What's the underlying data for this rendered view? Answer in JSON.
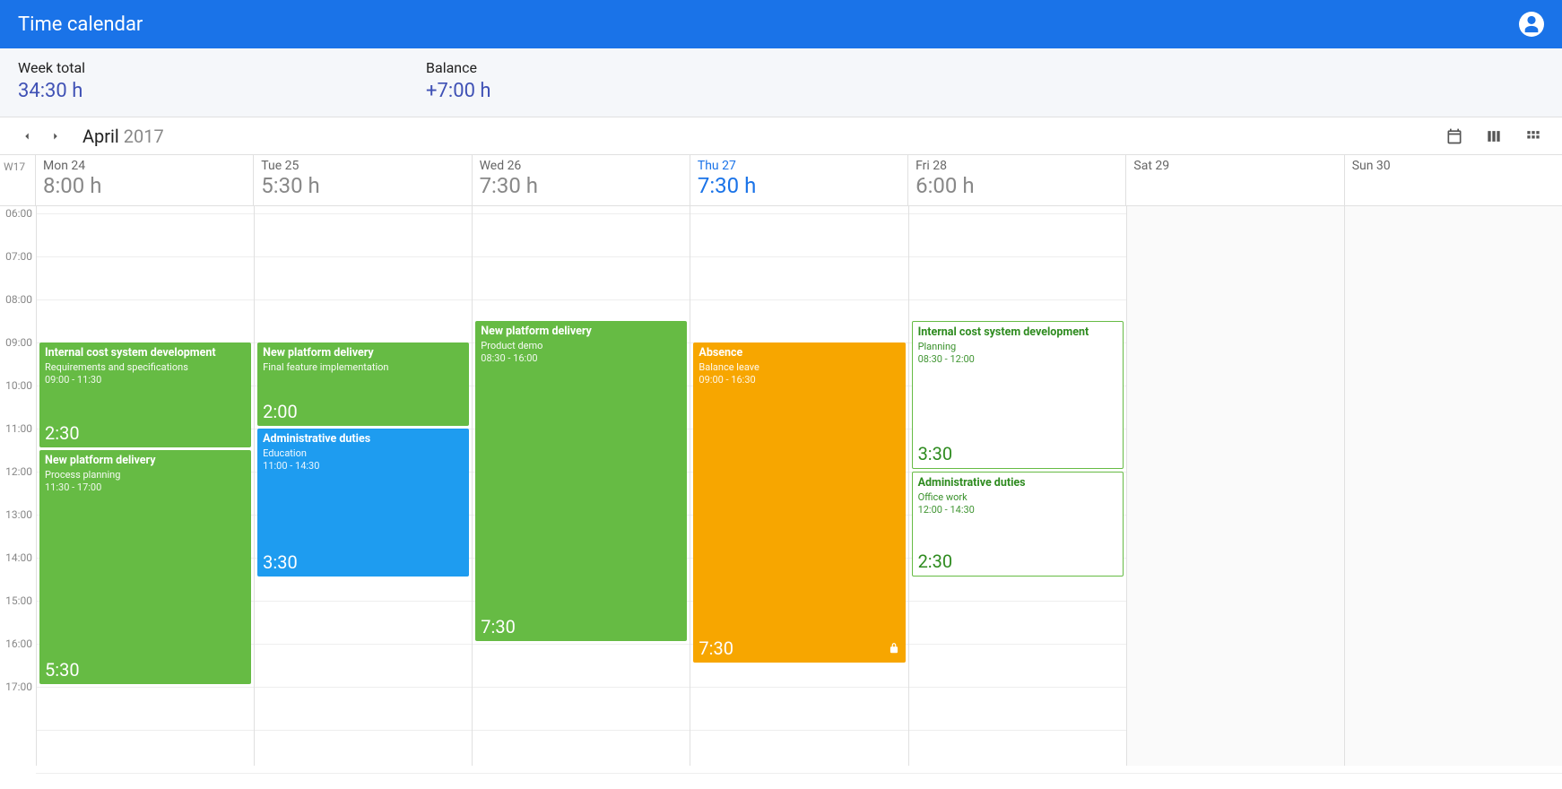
{
  "header": {
    "title": "Time calendar"
  },
  "summary": {
    "weekTotalLabel": "Week total",
    "weekTotalValue": "34:30 h",
    "balanceLabel": "Balance",
    "balanceValue": "+7:00 h"
  },
  "nav": {
    "month": "April",
    "year": "2017"
  },
  "weekLabel": "W17",
  "days": [
    {
      "label": "Mon 24",
      "hours": "8:00 h",
      "today": false,
      "weekend": false
    },
    {
      "label": "Tue 25",
      "hours": "5:30 h",
      "today": false,
      "weekend": false
    },
    {
      "label": "Wed 26",
      "hours": "7:30 h",
      "today": false,
      "weekend": false
    },
    {
      "label": "Thu 27",
      "hours": "7:30 h",
      "today": true,
      "weekend": false
    },
    {
      "label": "Fri 28",
      "hours": "6:00 h",
      "today": false,
      "weekend": false
    },
    {
      "label": "Sat 29",
      "hours": "",
      "today": false,
      "weekend": true
    },
    {
      "label": "Sun 30",
      "hours": "",
      "today": false,
      "weekend": true
    }
  ],
  "timeTicks": [
    "06:00",
    "07:00",
    "08:00",
    "09:00",
    "10:00",
    "11:00",
    "12:00",
    "13:00",
    "14:00",
    "15:00",
    "16:00",
    "17:00"
  ],
  "gridStartHour": 6,
  "hourPx": 48,
  "events": [
    {
      "day": 0,
      "title": "Internal cost system development",
      "sub": "Requirements and specifications",
      "time": "09:00 - 11:30",
      "startH": 9,
      "endH": 11.5,
      "dur": "2:30",
      "style": "green"
    },
    {
      "day": 0,
      "title": "New platform delivery",
      "sub": "Process planning",
      "time": "11:30 - 17:00",
      "startH": 11.5,
      "endH": 17,
      "dur": "5:30",
      "style": "green"
    },
    {
      "day": 1,
      "title": "New platform delivery",
      "sub": "Final feature implementation",
      "time": "",
      "startH": 9,
      "endH": 11,
      "dur": "2:00",
      "style": "green"
    },
    {
      "day": 1,
      "title": "Administrative duties",
      "sub": "Education",
      "time": "11:00 - 14:30",
      "startH": 11,
      "endH": 14.5,
      "dur": "3:30",
      "style": "blue"
    },
    {
      "day": 2,
      "title": "New platform delivery",
      "sub": "Product demo",
      "time": "08:30 - 16:00",
      "startH": 8.5,
      "endH": 16,
      "dur": "7:30",
      "style": "green"
    },
    {
      "day": 3,
      "title": "Absence",
      "sub": "Balance leave",
      "time": "09:00 - 16:30",
      "startH": 9,
      "endH": 16.5,
      "dur": "7:30",
      "style": "orange",
      "locked": true
    },
    {
      "day": 4,
      "title": "Internal cost system development",
      "sub": "Planning",
      "time": "08:30 - 12:00",
      "startH": 8.5,
      "endH": 12,
      "dur": "3:30",
      "style": "outline-green"
    },
    {
      "day": 4,
      "title": "Administrative duties",
      "sub": "Office work",
      "time": "12:00 - 14:30",
      "startH": 12,
      "endH": 14.5,
      "dur": "2:30",
      "style": "outline-green"
    }
  ]
}
